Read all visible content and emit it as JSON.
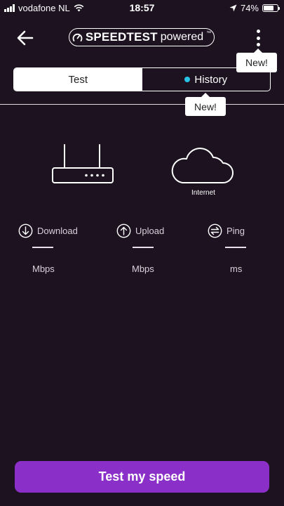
{
  "status_bar": {
    "carrier": "vodafone NL",
    "time": "18:57",
    "battery": "74%",
    "battery_level": 0.74
  },
  "header": {
    "brand_bold": "SPEEDTEST",
    "brand_light": "powered",
    "brand_tm": "™"
  },
  "tooltips": {
    "menu": "New!",
    "history": "New!"
  },
  "tabs": [
    {
      "label": "Test",
      "selected": true
    },
    {
      "label": "History",
      "selected": false
    }
  ],
  "network": {
    "internet_label": "Internet"
  },
  "metrics": {
    "download": {
      "label": "Download",
      "unit": "Mbps"
    },
    "upload": {
      "label": "Upload",
      "unit": "Mbps"
    },
    "ping": {
      "label": "Ping",
      "unit": "ms"
    }
  },
  "action": {
    "button_label": "Test my speed"
  },
  "colors": {
    "background": "#1c1220",
    "accent": "#8b2fc9",
    "history_dot": "#29c3e6"
  },
  "icons": [
    "signal-icon",
    "wifi-icon",
    "location-arrow-icon",
    "battery-icon",
    "back-arrow-icon",
    "speedometer-icon",
    "more-vertical-icon",
    "router-icon",
    "cloud-icon",
    "download-icon",
    "upload-icon",
    "ping-icon"
  ]
}
